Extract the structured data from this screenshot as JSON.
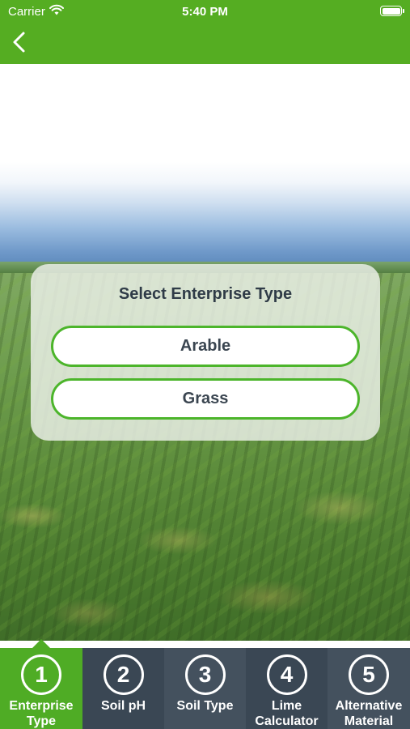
{
  "status_bar": {
    "carrier": "Carrier",
    "time": "5:40 PM"
  },
  "nav": {
    "back_icon": "chevron-left-icon"
  },
  "card": {
    "title": "Select Enterprise Type",
    "options": [
      "Arable",
      "Grass"
    ]
  },
  "tabs": [
    {
      "number": "1",
      "label": "Enterprise Type",
      "active": true
    },
    {
      "number": "2",
      "label": "Soil pH",
      "active": false
    },
    {
      "number": "3",
      "label": "Soil Type",
      "active": false
    },
    {
      "number": "4",
      "label": "Lime Calculator",
      "active": false
    },
    {
      "number": "5",
      "label": "Alternative Material",
      "active": false
    }
  ],
  "colors": {
    "brand_green": "#55ad22",
    "tab_bar": "#3d4a57",
    "accent_border": "#4cb52b"
  }
}
